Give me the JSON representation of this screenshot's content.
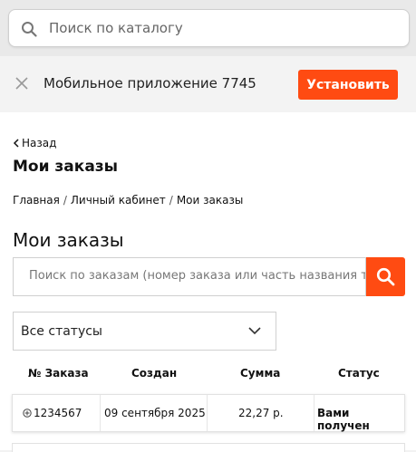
{
  "top_search": {
    "placeholder": "Поиск по каталогу",
    "icon": "search-icon"
  },
  "app_banner": {
    "title": "Мобильное приложение 7745",
    "install_label": "Установить",
    "close_icon": "close-icon",
    "accent": "#ff4b12"
  },
  "page": {
    "back_label": "Назад",
    "title_small": "Мои заказы",
    "breadcrumb": [
      "Главная",
      "Личный кабинет",
      "Мои заказы"
    ],
    "breadcrumb_sep": "/",
    "title_big": "Мои заказы"
  },
  "orders_search": {
    "placeholder": "Поиск по заказам (номер заказа или часть названия товара)",
    "button_icon": "search-icon"
  },
  "status_filter": {
    "selected": "Все статусы"
  },
  "table": {
    "headers": [
      "№ Заказа",
      "Создан",
      "Сумма",
      "Статус"
    ],
    "rows": [
      {
        "number": "1234567",
        "created": "09 сентября 2025",
        "sum": "22,27 р.",
        "status": "Вами получен"
      }
    ]
  }
}
